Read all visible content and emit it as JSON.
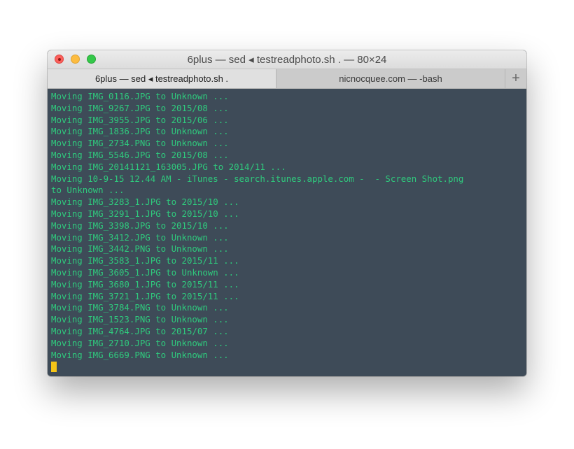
{
  "window": {
    "title": "6plus — sed ◂ testreadphoto.sh . — 80×24"
  },
  "tabs": [
    {
      "label": "6plus — sed ◂ testreadphoto.sh .",
      "active": true
    },
    {
      "label": "nicnocquee.com — -bash",
      "active": false
    }
  ],
  "new_tab_label": "+",
  "terminal": {
    "text_color": "#2fca7d",
    "background": "#3e4b58",
    "cursor_color": "#f5c518",
    "lines": [
      "Moving IMG_0116.JPG to Unknown ...",
      "Moving IMG_9267.JPG to 2015/08 ...",
      "Moving IMG_3955.JPG to 2015/06 ...",
      "Moving IMG_1836.JPG to Unknown ...",
      "Moving IMG_2734.PNG to Unknown ...",
      "Moving IMG_5546.JPG to 2015/08 ...",
      "Moving IMG_20141121_163005.JPG to 2014/11 ...",
      "Moving 10-9-15 12.44 AM - iTunes - search.itunes.apple.com -  - Screen Shot.png",
      "to Unknown ...",
      "Moving IMG_3283_1.JPG to 2015/10 ...",
      "Moving IMG_3291_1.JPG to 2015/10 ...",
      "Moving IMG_3398.JPG to 2015/10 ...",
      "Moving IMG_3412.JPG to Unknown ...",
      "Moving IMG_3442.PNG to Unknown ...",
      "Moving IMG_3583_1.JPG to 2015/11 ...",
      "Moving IMG_3605_1.JPG to Unknown ...",
      "Moving IMG_3680_1.JPG to 2015/11 ...",
      "Moving IMG_3721_1.JPG to 2015/11 ...",
      "Moving IMG_3784.PNG to Unknown ...",
      "Moving IMG_1523.PNG to Unknown ...",
      "Moving IMG_4764.JPG to 2015/07 ...",
      "Moving IMG_2710.JPG to Unknown ...",
      "Moving IMG_6669.PNG to Unknown ..."
    ]
  }
}
